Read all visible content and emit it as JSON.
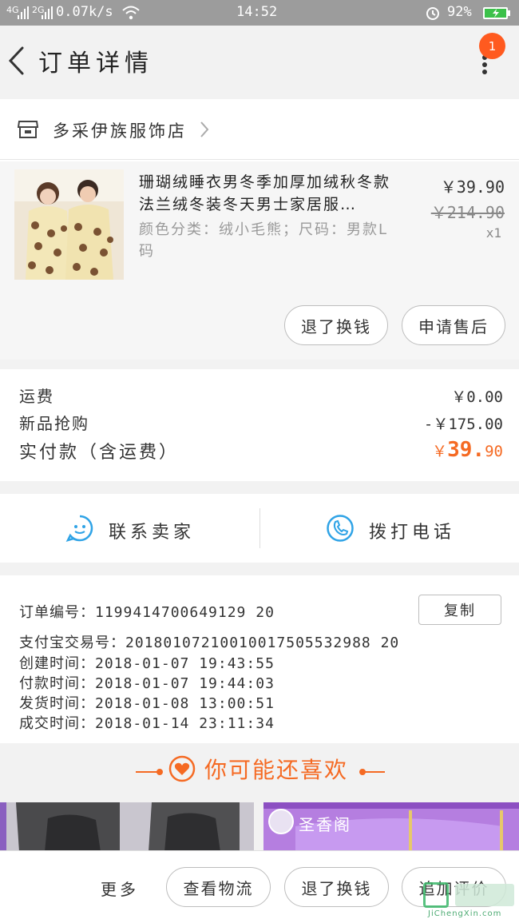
{
  "status_bar": {
    "signal_1": "4G",
    "signal_2": "2G",
    "speed": "0.07k/s",
    "time": "14:52",
    "battery": "92%"
  },
  "header": {
    "title": "订单详情",
    "notification_count": "1"
  },
  "store": {
    "name": "多采伊族服饰店"
  },
  "product": {
    "title": "珊瑚绒睡衣男冬季加厚加绒秋冬款法兰绒冬装冬天男士家居服…",
    "spec": "颜色分类：绒小毛熊；尺码：男款L码",
    "price": "￥39.90",
    "original_price": "￥214.90",
    "quantity": "x1",
    "refund_button": "退了换钱",
    "after_sale_button": "申请售后"
  },
  "costs": {
    "shipping_label": "运费",
    "shipping_value": "￥0.00",
    "discount_label": "新品抢购",
    "discount_value": "-￥175.00",
    "paid_label": "实付款（含运费）",
    "paid_currency": "￥",
    "paid_main": "39.",
    "paid_decimal": "90"
  },
  "contact": {
    "chat_label": "联系卖家",
    "call_label": "拨打电话"
  },
  "order_info": {
    "order_no_label": "订单编号：",
    "order_no": "1199414700649129 20",
    "copy_button": "复制",
    "alipay_label": "支付宝交易号：",
    "alipay_no": "20180107210010017505532988 20",
    "created_label": "创建时间：",
    "created": "2018-01-07 19:43:55",
    "paid_label": "付款时间：",
    "paid": "2018-01-07 19:44:03",
    "shipped_label": "发货时间：",
    "shipped": "2018-01-08 13:00:51",
    "completed_label": "成交时间：",
    "completed": "2018-01-14 23:11:34"
  },
  "recommend": {
    "title": "你可能还喜欢",
    "shop_badge": "圣香阁"
  },
  "bottom_bar": {
    "more": "更多",
    "logistics_button": "查看物流",
    "refund_button": "退了换钱",
    "review_button": "追加评价"
  },
  "watermark": {
    "text": "JiChengXin.com"
  },
  "colors": {
    "accent": "#f56a23",
    "blue_icon": "#2fa3e6",
    "badge": "#ff5a1f"
  }
}
